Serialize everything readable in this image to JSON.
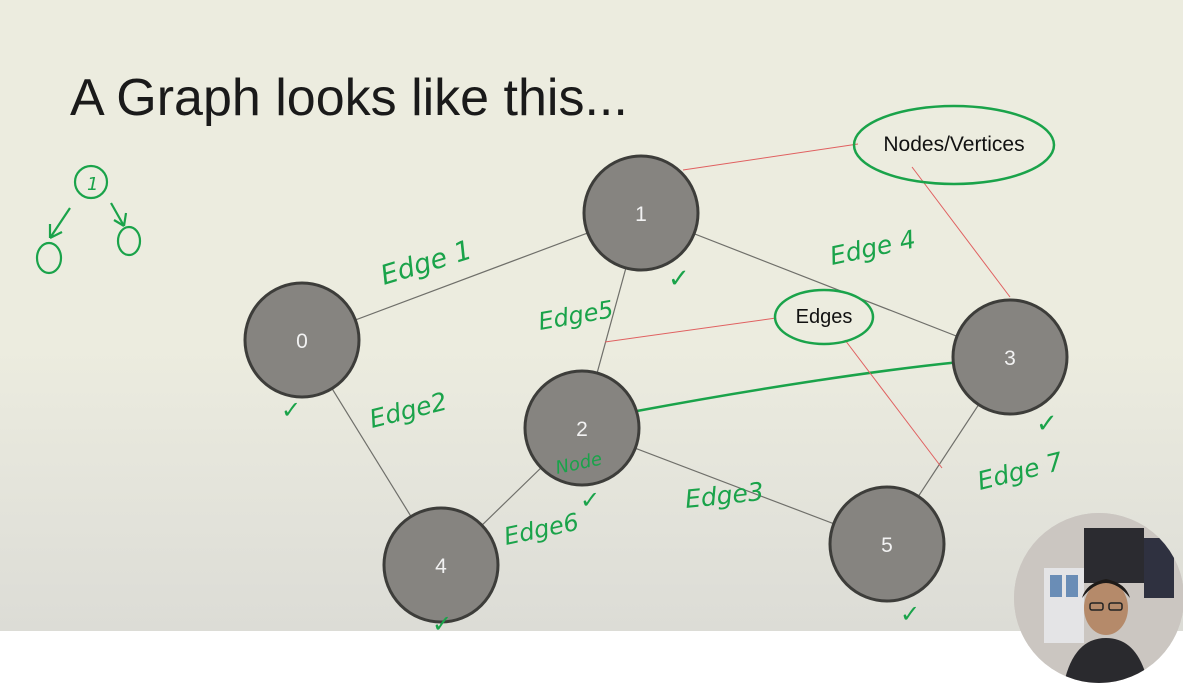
{
  "slide": {
    "title": "A Graph looks like this..."
  },
  "graph": {
    "nodes": [
      {
        "id": "0",
        "label": "0"
      },
      {
        "id": "1",
        "label": "1"
      },
      {
        "id": "2",
        "label": "2"
      },
      {
        "id": "3",
        "label": "3"
      },
      {
        "id": "4",
        "label": "4"
      },
      {
        "id": "5",
        "label": "5"
      }
    ],
    "edges": [
      {
        "from": "0",
        "to": "1"
      },
      {
        "from": "0",
        "to": "4"
      },
      {
        "from": "1",
        "to": "2"
      },
      {
        "from": "1",
        "to": "3"
      },
      {
        "from": "2",
        "to": "4"
      },
      {
        "from": "2",
        "to": "5"
      },
      {
        "from": "3",
        "to": "5"
      }
    ]
  },
  "callouts": {
    "nodes_vertices": "Nodes/Vertices",
    "edges": "Edges"
  },
  "annotations": {
    "edge_1": "Edge 1",
    "edge_2": "Edge2",
    "edge_3": "Edge3",
    "edge_4": "Edge 4",
    "edge_5": "Edge5",
    "edge_6": "Edge6",
    "edge_7": "Edge 7",
    "node_note": "Node",
    "mini_tree_root": "1",
    "checkmark": "✓"
  },
  "colors": {
    "background": "#ececdf",
    "node_fill": "#868480",
    "node_stroke": "#3d3d3a",
    "edge_line": "#6f6f6a",
    "ink_green": "#1aa34a",
    "pointer_red": "#e06060",
    "title_text": "#1a1a1a"
  }
}
